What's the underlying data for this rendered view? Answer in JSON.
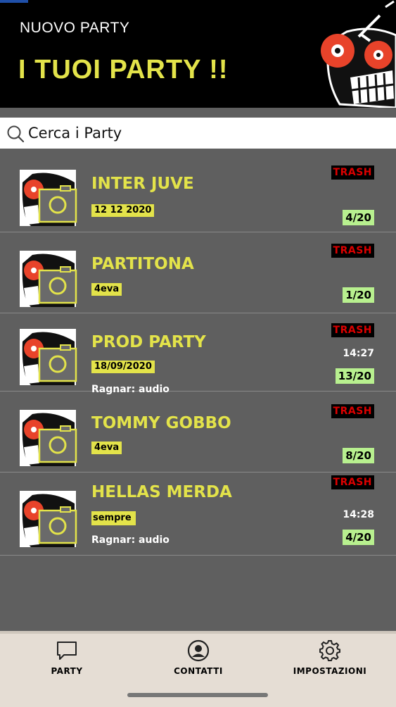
{
  "header": {
    "new_party_label": "NUOVO PARTY",
    "title": "I TUOI PARTY !!"
  },
  "search": {
    "placeholder": "Cerca i Party"
  },
  "parties": [
    {
      "title": "INTER JUVE",
      "subtitle": "12 12 2020",
      "tag": "TRASH",
      "time": "",
      "message": "",
      "count": "4/20"
    },
    {
      "title": "PARTITONA",
      "subtitle": "4eva",
      "tag": "TRASH",
      "time": "",
      "message": "",
      "count": "1/20"
    },
    {
      "title": "PROD PARTY",
      "subtitle": "18/09/2020",
      "tag": "TRASH",
      "time": "14:27",
      "message": "Ragnar: audio",
      "count": "13/20"
    },
    {
      "title": "TOMMY GOBBO",
      "subtitle": "4eva",
      "tag": "TRASH",
      "time": "",
      "message": "",
      "count": "8/20"
    },
    {
      "title": "HELLAS MERDA",
      "subtitle": "sempre",
      "tag": "TRASH",
      "time": "14:28",
      "message": "Ragnar: audio",
      "count": "4/20"
    }
  ],
  "tabs": [
    {
      "label": "PARTY",
      "icon": "chat-bubble-icon"
    },
    {
      "label": "CONTATTI",
      "icon": "contact-icon"
    },
    {
      "label": "IMPOSTAZIONI",
      "icon": "gear-icon"
    }
  ],
  "colors": {
    "accent": "#e3e34a",
    "header_bg": "#000000",
    "list_bg": "#5f5f5f",
    "count_badge": "#b8f08f",
    "trash_text": "#dd0000",
    "tab_bar_bg": "#e5ddd4"
  }
}
